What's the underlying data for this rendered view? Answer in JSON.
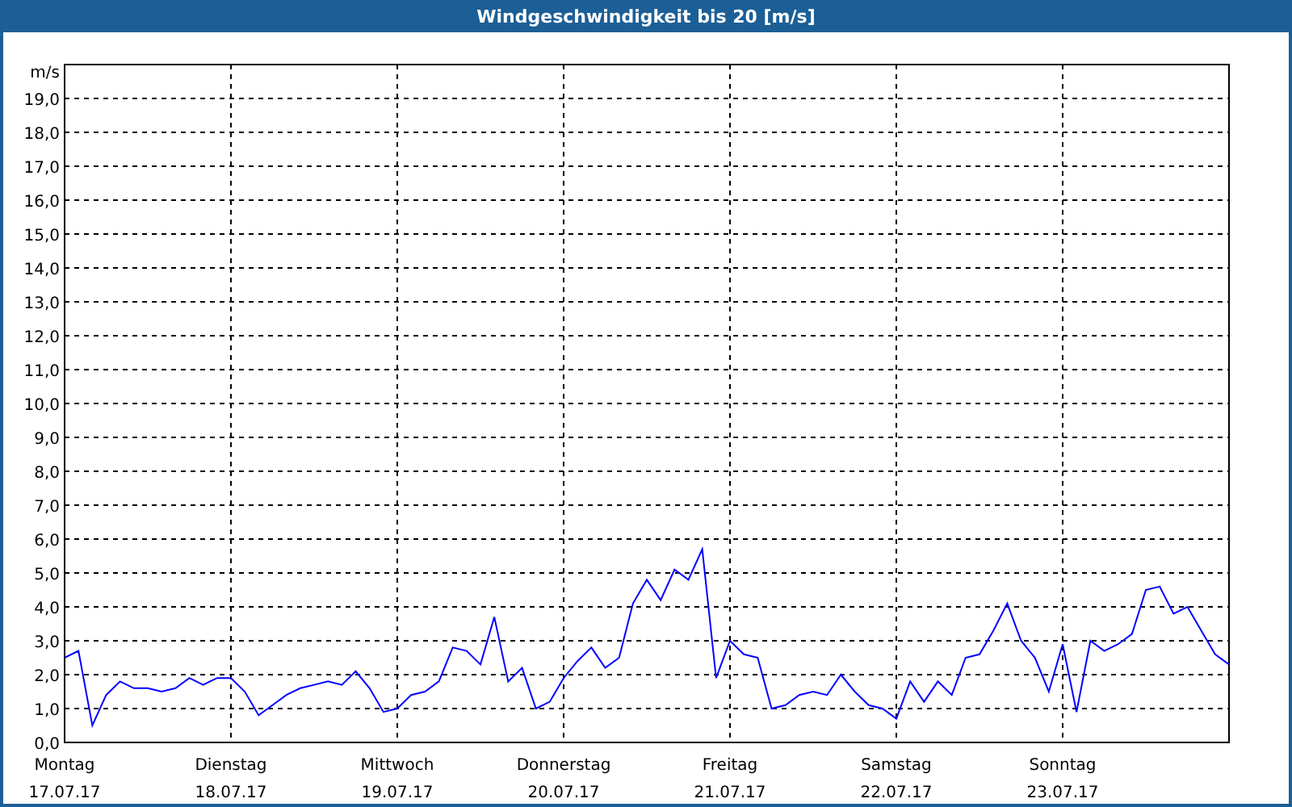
{
  "window": {
    "title": "Windgeschwindigkeit bis 20 [m/s]"
  },
  "chart": {
    "xtick_dates": [
      "17.07.17",
      "18.07.17",
      "19.07.17",
      "20.07.17",
      "21.07.17",
      "22.07.17",
      "23.07.17"
    ],
    "chart_data": {
      "type": "line",
      "grid": true,
      "ylabel": "m/s",
      "ylim": [
        0,
        20
      ],
      "yticks": [
        {
          "value": 0,
          "label": "0,0"
        },
        {
          "value": 1,
          "label": "1,0"
        },
        {
          "value": 2,
          "label": "2,0"
        },
        {
          "value": 3,
          "label": "3,0"
        },
        {
          "value": 4,
          "label": "4,0"
        },
        {
          "value": 5,
          "label": "5,0"
        },
        {
          "value": 6,
          "label": "6,0"
        },
        {
          "value": 7,
          "label": "7,0"
        },
        {
          "value": 8,
          "label": "8,0"
        },
        {
          "value": 9,
          "label": "9,0"
        },
        {
          "value": 10,
          "label": "10,0"
        },
        {
          "value": 11,
          "label": "11,0"
        },
        {
          "value": 12,
          "label": "12,0"
        },
        {
          "value": 13,
          "label": "13,0"
        },
        {
          "value": 14,
          "label": "14,0"
        },
        {
          "value": 15,
          "label": "15,0"
        },
        {
          "value": 16,
          "label": "16,0"
        },
        {
          "value": 17,
          "label": "17,0"
        },
        {
          "value": 18,
          "label": "18,0"
        },
        {
          "value": 19,
          "label": "19,0"
        }
      ],
      "categories": [
        "Montag",
        null,
        null,
        null,
        null,
        null,
        null,
        null,
        null,
        null,
        null,
        null,
        "Dienstag",
        null,
        null,
        null,
        null,
        null,
        null,
        null,
        null,
        null,
        null,
        null,
        "Mittwoch",
        null,
        null,
        null,
        null,
        null,
        null,
        null,
        null,
        null,
        null,
        null,
        "Donnerstag",
        null,
        null,
        null,
        null,
        null,
        null,
        null,
        null,
        null,
        null,
        null,
        "Freitag",
        null,
        null,
        null,
        null,
        null,
        null,
        null,
        null,
        null,
        null,
        null,
        "Samstag",
        null,
        null,
        null,
        null,
        null,
        null,
        null,
        null,
        null,
        null,
        null,
        "Sonntag",
        null,
        null,
        null,
        null,
        null,
        null,
        null,
        null,
        null,
        null,
        null,
        null
      ],
      "series": [
        {
          "color": "#0000ff",
          "values": [
            2.5,
            2.7,
            0.5,
            1.4,
            1.8,
            1.6,
            1.6,
            1.5,
            1.6,
            1.9,
            1.7,
            1.9,
            1.9,
            1.5,
            0.8,
            1.1,
            1.4,
            1.6,
            1.7,
            1.8,
            1.7,
            2.1,
            1.6,
            0.9,
            1.0,
            1.4,
            1.5,
            1.8,
            2.8,
            2.7,
            2.3,
            3.7,
            1.8,
            2.2,
            1.0,
            1.2,
            1.9,
            2.4,
            2.8,
            2.2,
            2.5,
            4.1,
            4.8,
            4.2,
            5.1,
            4.8,
            5.7,
            1.9,
            3.0,
            2.6,
            2.5,
            1.0,
            1.1,
            1.4,
            1.5,
            1.4,
            2.0,
            1.5,
            1.1,
            1.0,
            0.7,
            1.8,
            1.2,
            1.8,
            1.4,
            2.5,
            2.6,
            3.3,
            4.1,
            3.0,
            2.5,
            1.5,
            2.9,
            0.9,
            3.0,
            2.7,
            2.9,
            3.2,
            4.5,
            4.6,
            3.8,
            4.0,
            3.3,
            2.6,
            2.3
          ]
        }
      ]
    }
  }
}
